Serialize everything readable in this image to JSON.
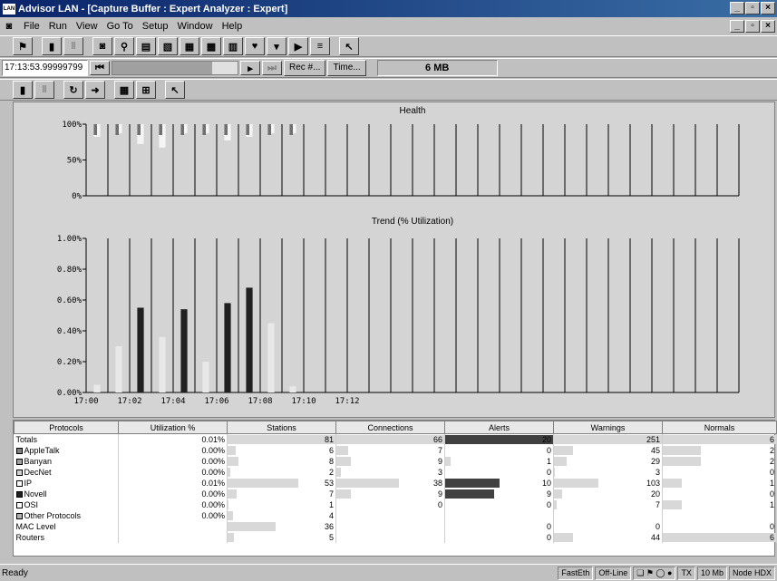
{
  "window": {
    "title": "Advisor LAN - [Capture Buffer : Expert Analyzer : Expert]",
    "app_icon_text": "LAN"
  },
  "menu": [
    "File",
    "Run",
    "View",
    "Go To",
    "Setup",
    "Window",
    "Help"
  ],
  "playback": {
    "time_value": "17:13:53.99999799",
    "rec_button": "Rec #...",
    "time_button": "Time...",
    "buffer_size": "6 MB"
  },
  "chart_data": [
    {
      "type": "bar",
      "title": "Health",
      "ylim": [
        0,
        100
      ],
      "yticks": [
        "0%",
        "50%",
        "100%"
      ],
      "x_ticks": [
        "17:00",
        "17:02",
        "17:04",
        "17:06",
        "17:08",
        "17:10",
        "17:12"
      ],
      "series": [
        {
          "name": "",
          "values": [
            95,
            100,
            85,
            80,
            100,
            100,
            90,
            95,
            100,
            100
          ]
        }
      ]
    },
    {
      "type": "bar",
      "title": "Trend (% Utilization)",
      "ylim": [
        0,
        1.0
      ],
      "yticks": [
        "0.00%",
        "0.20%",
        "0.40%",
        "0.60%",
        "0.80%",
        "1.00%"
      ],
      "x_ticks": [
        "17:00",
        "17:02",
        "17:04",
        "17:06",
        "17:08",
        "17:10",
        "17:12"
      ],
      "series": [
        {
          "name": "",
          "values": [
            0.05,
            0.3,
            0.55,
            0.36,
            0.54,
            0.2,
            0.58,
            0.68,
            0.45,
            0.04
          ]
        }
      ]
    }
  ],
  "table": {
    "columns": [
      "Protocols",
      "Utilization %",
      "Stations",
      "Connections",
      "Alerts",
      "Warnings",
      "Normals"
    ],
    "rows": [
      {
        "name": "Totals",
        "swatch": "",
        "util": "0.01%",
        "stations": "81",
        "connections": "66",
        "alerts": "20",
        "warnings": "251",
        "normals": "6"
      },
      {
        "name": "AppleTalk",
        "swatch": "#808080",
        "util": "0.00%",
        "stations": "6",
        "connections": "7",
        "alerts": "0",
        "warnings": "45",
        "normals": "2"
      },
      {
        "name": "Banyan",
        "swatch": "#a0a0a0",
        "util": "0.00%",
        "stations": "8",
        "connections": "9",
        "alerts": "1",
        "warnings": "29",
        "normals": "2"
      },
      {
        "name": "DecNet",
        "swatch": "#d0d0d0",
        "util": "0.00%",
        "stations": "2",
        "connections": "3",
        "alerts": "0",
        "warnings": "3",
        "normals": "0"
      },
      {
        "name": "IP",
        "swatch": "#ffffff",
        "util": "0.01%",
        "stations": "53",
        "connections": "38",
        "alerts": "10",
        "warnings": "103",
        "normals": "1"
      },
      {
        "name": "Novell",
        "swatch": "#202020",
        "util": "0.00%",
        "stations": "7",
        "connections": "9",
        "alerts": "9",
        "warnings": "20",
        "normals": "0"
      },
      {
        "name": "OSI",
        "swatch": "#ffffff",
        "util": "0.00%",
        "stations": "1",
        "connections": "0",
        "alerts": "0",
        "warnings": "7",
        "normals": "1"
      },
      {
        "name": "Other Protocols",
        "swatch": "#b0b0b0",
        "util": "0.00%",
        "stations": "4",
        "connections": "",
        "alerts": "",
        "warnings": "",
        "normals": ""
      },
      {
        "name": "MAC Level",
        "swatch": "",
        "util": "",
        "stations": "36",
        "connections": "",
        "alerts": "0",
        "warnings": "0",
        "normals": "0"
      },
      {
        "name": "Routers",
        "swatch": "",
        "util": "",
        "stations": "5",
        "connections": "",
        "alerts": "0",
        "warnings": "44",
        "normals": "6"
      }
    ]
  },
  "status": {
    "ready": "Ready",
    "network": "FastEth",
    "mode": "Off-Line",
    "tx": "TX",
    "speed": "10 Mb",
    "duplex": "Node HDX"
  }
}
